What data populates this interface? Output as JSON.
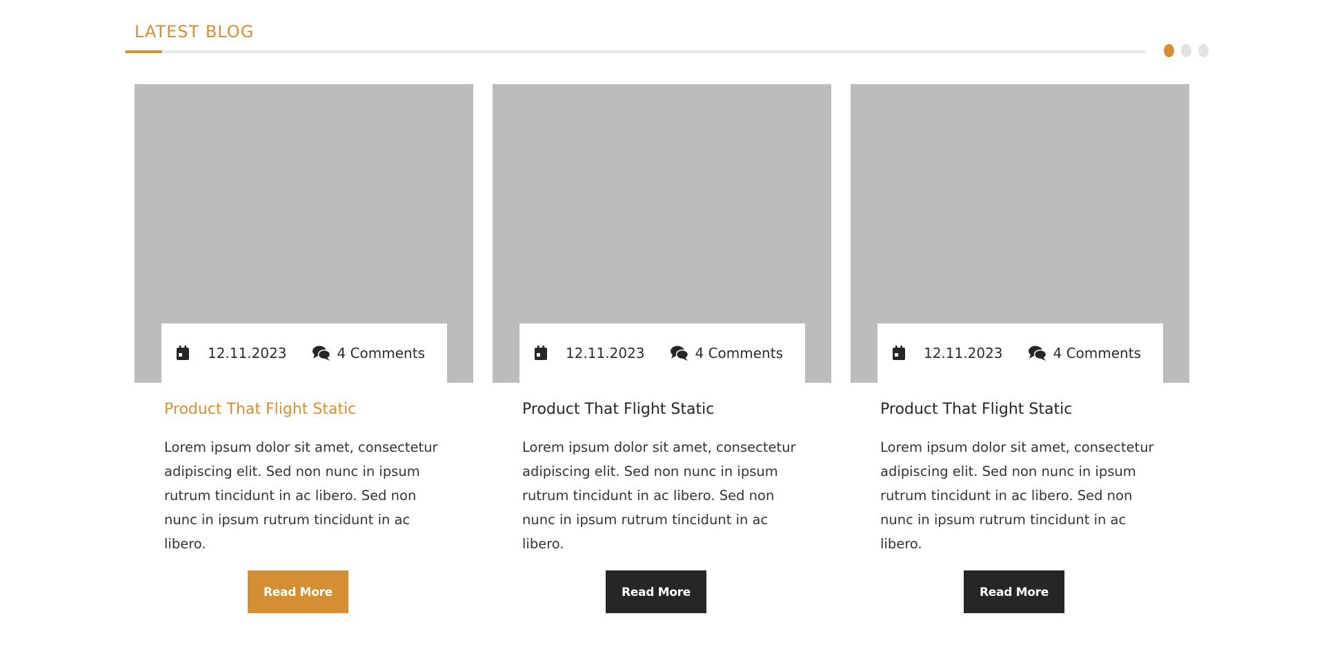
{
  "section": {
    "title": "LATEST BLOG"
  },
  "colors": {
    "accent": "#d48f33",
    "dark": "#262626",
    "image_placeholder": "#bcbcbc",
    "dot_inactive": "#e2e2e2",
    "line": "#e6e6e6"
  },
  "carousel": {
    "dots": 3,
    "active": 0
  },
  "posts": [
    {
      "date": "12.11.2023",
      "comments": "4 Comments",
      "title": "Product That Flight Static",
      "excerpt": "Lorem ipsum dolor sit amet, consectetur adipiscing elit. Sed non nunc in ipsum rutrum tincidunt in ac libero. Sed non nunc in ipsum rutrum tincidunt in ac libero.",
      "button": "Read More",
      "highlighted": true
    },
    {
      "date": "12.11.2023",
      "comments": "4 Comments",
      "title": "Product That Flight Static",
      "excerpt": "Lorem ipsum dolor sit amet, consectetur adipiscing elit. Sed non nunc in ipsum rutrum tincidunt in ac libero. Sed non nunc in ipsum rutrum tincidunt in ac libero.",
      "button": "Read More",
      "highlighted": false
    },
    {
      "date": "12.11.2023",
      "comments": "4 Comments",
      "title": "Product That Flight Static",
      "excerpt": "Lorem ipsum dolor sit amet, consectetur adipiscing elit. Sed non nunc in ipsum rutrum tincidunt in ac libero. Sed non nunc in ipsum rutrum tincidunt in ac libero.",
      "button": "Read More",
      "highlighted": false
    }
  ],
  "icons": {
    "date": "calendar-icon",
    "comments": "comments-icon"
  }
}
